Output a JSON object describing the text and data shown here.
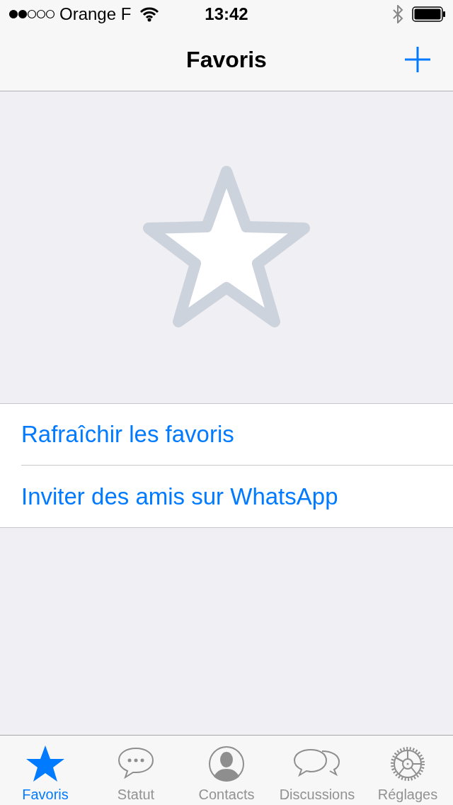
{
  "status_bar": {
    "carrier": "Orange F",
    "time": "13:42"
  },
  "nav": {
    "title": "Favoris"
  },
  "actions": [
    {
      "label": "Rafraîchir les favoris"
    },
    {
      "label": "Inviter des amis sur WhatsApp"
    }
  ],
  "tabs": [
    {
      "label": "Favoris",
      "kind": "star",
      "selected": true
    },
    {
      "label": "Statut",
      "kind": "status",
      "selected": false
    },
    {
      "label": "Contacts",
      "kind": "contacts",
      "selected": false
    },
    {
      "label": "Discussions",
      "kind": "chats",
      "selected": false
    },
    {
      "label": "Réglages",
      "kind": "settings",
      "selected": false
    }
  ]
}
